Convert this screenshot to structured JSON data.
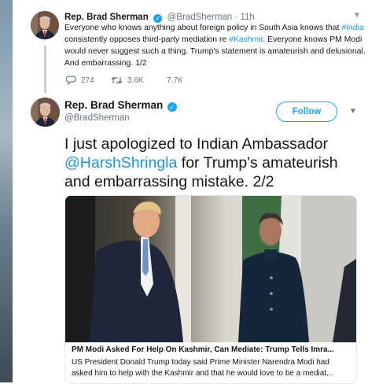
{
  "tweet1": {
    "author_name": "Rep. Brad Sherman",
    "handle_line": "@BradSherman · 11h",
    "body_parts": [
      {
        "text": "Everyone who knows anything about foreign policy in South Asia knows that ",
        "link": false
      },
      {
        "text": "#India",
        "link": true
      },
      {
        "text": " consistently opposes third-party mediation re ",
        "link": false
      },
      {
        "text": "#Kashmir",
        "link": true
      },
      {
        "text": ". Everyone knows PM Modi would never suggest such a thing. Trump's statement is amateurish and delusional. And embarrassing. 1/2",
        "link": false
      }
    ],
    "reply_count": "274",
    "retweet_count": "3.6K",
    "like_count": "7.7K"
  },
  "tweet2": {
    "author_name": "Rep. Brad Sherman",
    "handle": "@BradSherman",
    "follow_label": "Follow",
    "body_before": "I just apologized to Indian Ambassador ",
    "mention": "@HarshShringla",
    "body_after": " for Trump's amateurish and embarrassing mistake. 2/2",
    "card": {
      "title": "PM Modi Asked For Help On Kashmir, Can Mediate: Trump Tells Imra...",
      "description": "US President Donald Trump today said Prime Minister Narendra Modi had asked him to help with the Kashmir and that he would love to be a mediat..."
    }
  },
  "colors": {
    "link": "#1b95e0",
    "verified": "#1da1f2",
    "muted": "#657786",
    "text": "#14171a"
  },
  "icons": [
    "verified-badge-icon",
    "chevron-down-icon",
    "reply-icon",
    "retweet-icon",
    "like-icon"
  ]
}
